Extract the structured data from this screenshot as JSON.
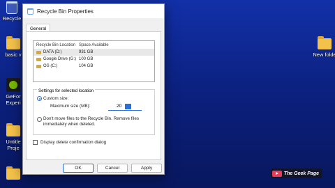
{
  "desktop": {
    "icons": [
      {
        "label": "Recycle",
        "icon": "recycle-bin-icon"
      },
      {
        "label": "basic v",
        "icon": "folder-icon"
      },
      {
        "label": "GeFor Experi",
        "icon": "nvidia-icon"
      },
      {
        "label": "Untitle Proje",
        "icon": "folder-icon"
      },
      {
        "label": "New folde",
        "icon": "folder-icon"
      }
    ]
  },
  "dialog": {
    "title": "Recycle Bin Properties",
    "tab": "General",
    "columns": [
      "Recycle Bin Location",
      "Space Available"
    ],
    "locations": [
      {
        "name": "DATA (D:)",
        "space": "931 GB"
      },
      {
        "name": "Google Drive (G:)",
        "space": "100 GB"
      },
      {
        "name": "OS (C:)",
        "space": "104 GB"
      }
    ],
    "settings_title": "Settings for selected location",
    "custom_size_label": "Custom size:",
    "max_size_label": "Maximum size (MB):",
    "max_size_value": "20",
    "dont_move_label_1": "Don't move files to the Recycle Bin. Remove files",
    "dont_move_label_2": "immediately when deleted.",
    "confirm_label": "Display delete confirmation dialog",
    "buttons": {
      "ok": "OK",
      "cancel": "Cancel",
      "apply": "Apply"
    }
  },
  "watermark": {
    "text": "The Geek Page"
  },
  "colors": {
    "accent": "#2a6fd6",
    "desktop": "#1230a8"
  }
}
